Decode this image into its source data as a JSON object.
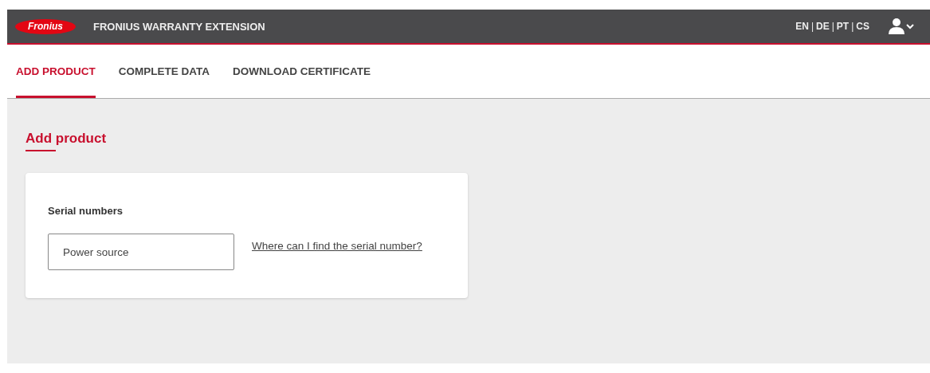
{
  "header": {
    "logo": "Fronius",
    "title": "FRONIUS WARRANTY EXTENSION",
    "languages": [
      {
        "label": "EN"
      },
      {
        "label": "DE"
      },
      {
        "label": "PT"
      },
      {
        "label": "CS"
      }
    ],
    "separator": "|"
  },
  "tabs": [
    {
      "label": "ADD PRODUCT",
      "selected": true
    },
    {
      "label": "COMPLETE DATA",
      "selected": false
    },
    {
      "label": "DOWNLOAD CERTIFICATE",
      "selected": false
    }
  ],
  "page_title": "Add product",
  "card": {
    "heading": "Serial numbers",
    "field": {
      "placeholder": "Power source"
    },
    "help_link": "Where can I find the serial number?"
  }
}
